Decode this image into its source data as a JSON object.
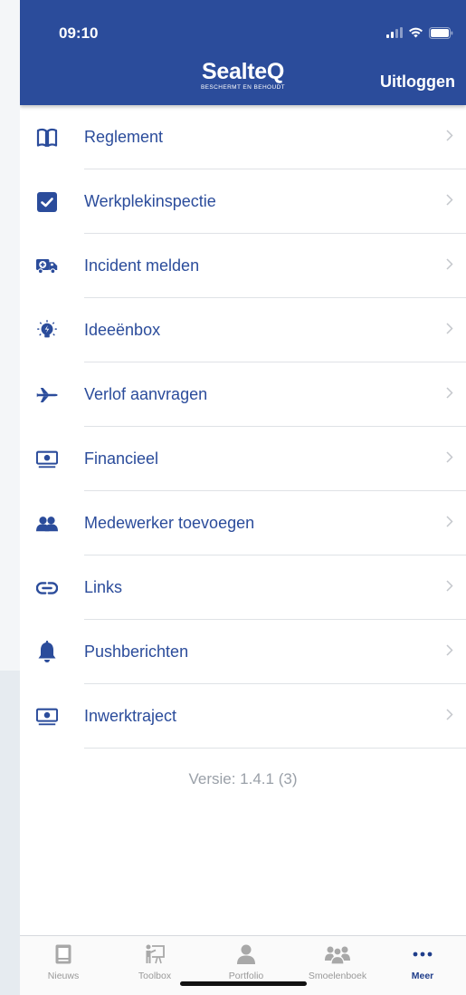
{
  "status_bar": {
    "time": "09:10"
  },
  "header": {
    "brand": "SealteQ",
    "tagline": "BESCHERMT EN BEHOUDT",
    "logout_label": "Uitloggen",
    "background": "#2b4c9b"
  },
  "menu": {
    "items": [
      {
        "label": "Reglement",
        "icon": "book-icon"
      },
      {
        "label": "Werkplekinspectie",
        "icon": "checkbox-icon"
      },
      {
        "label": "Incident melden",
        "icon": "ambulance-icon"
      },
      {
        "label": "Ideeënbox",
        "icon": "lightbulb-icon"
      },
      {
        "label": "Verlof aanvragen",
        "icon": "airplane-icon"
      },
      {
        "label": "Financieel",
        "icon": "money-icon"
      },
      {
        "label": "Medewerker toevoegen",
        "icon": "users-icon"
      },
      {
        "label": "Links",
        "icon": "link-icon"
      },
      {
        "label": "Pushberichten",
        "icon": "bell-icon"
      },
      {
        "label": "Inwerktraject",
        "icon": "money-icon"
      }
    ]
  },
  "version_text": "Versie: 1.4.1 (3)",
  "tabbar": {
    "tabs": [
      {
        "label": "Nieuws",
        "icon": "newspaper-icon",
        "active": false
      },
      {
        "label": "Toolbox",
        "icon": "presentation-icon",
        "active": false
      },
      {
        "label": "Portfolio",
        "icon": "person-icon",
        "active": false
      },
      {
        "label": "Smoelenboek",
        "icon": "group-icon",
        "active": false
      },
      {
        "label": "Meer",
        "icon": "more-icon",
        "active": true
      }
    ]
  },
  "colors": {
    "accent": "#2b4c9b",
    "active_tab": "#1f3d8a",
    "muted": "#999999"
  }
}
